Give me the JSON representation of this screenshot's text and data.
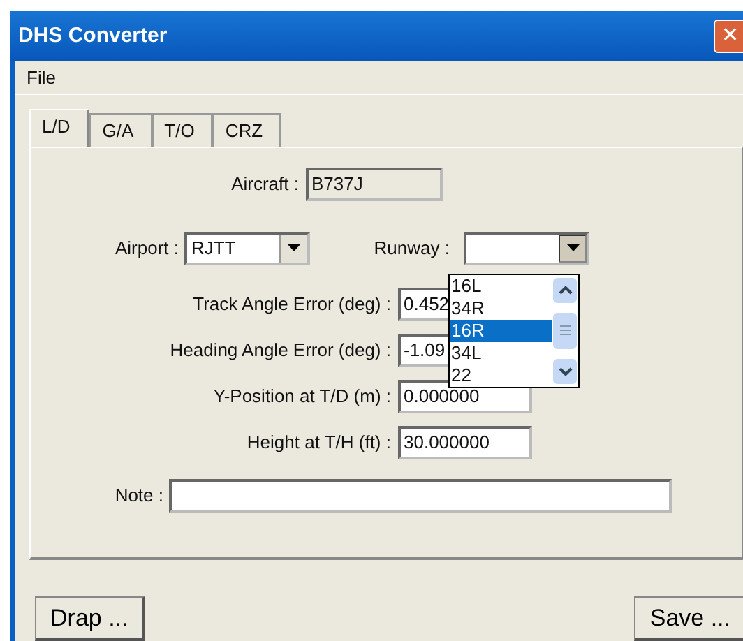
{
  "window": {
    "title": "DHS Converter",
    "close": "✕"
  },
  "menu": [
    "File"
  ],
  "tabs": [
    {
      "label": "L/D",
      "selected": true
    },
    {
      "label": "G/A",
      "selected": false
    },
    {
      "label": "T/O",
      "selected": false
    },
    {
      "label": "CRZ",
      "selected": false
    }
  ],
  "aircraft": {
    "label": "Aircraft :",
    "value": "B737J"
  },
  "airport": {
    "label": "Airport :",
    "value": "RJTT"
  },
  "runway": {
    "label": "Runway :",
    "expanded": true,
    "options": [
      {
        "label": "16L",
        "selected": false
      },
      {
        "label": "34R",
        "selected": false
      },
      {
        "label": "16R",
        "selected": true
      },
      {
        "label": "34L",
        "selected": false
      },
      {
        "label": "22",
        "selected": false
      }
    ]
  },
  "fields": [
    {
      "label": "Track Angle Error (deg) :",
      "value": "0.452"
    },
    {
      "label": "Heading Angle Error (deg) :",
      "value": "-1.09"
    },
    {
      "label": "Y-Position at T/D (m) :",
      "value": "0.000000"
    },
    {
      "label": "Height at T/H (ft) :",
      "value": "30.000000"
    }
  ],
  "note": {
    "label": "Note :"
  },
  "buttons": [
    {
      "label": "Drap ..."
    },
    {
      "label": "Save ..."
    }
  ]
}
